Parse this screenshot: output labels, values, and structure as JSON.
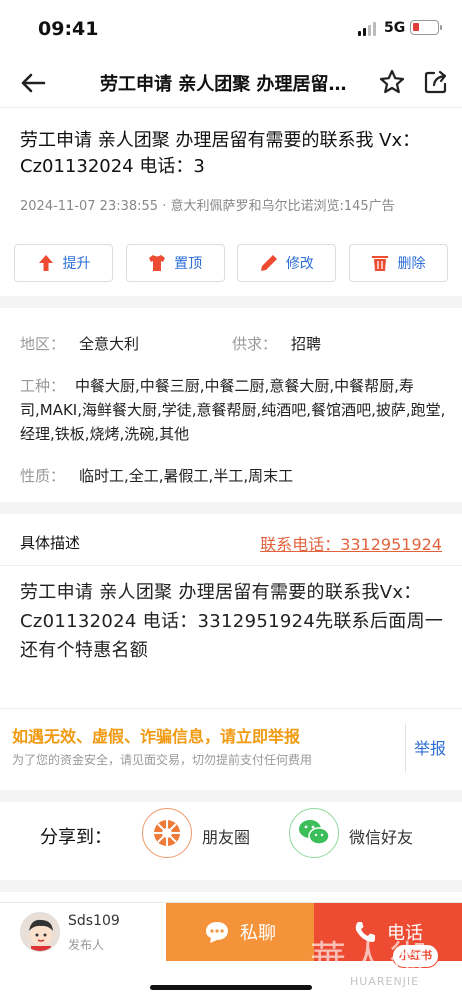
{
  "status": {
    "time": "09:41",
    "network": "5G"
  },
  "nav": {
    "title": "劳工申请 亲人团聚 办理居留有需要的联系我"
  },
  "post": {
    "title": "劳工申请 亲人团聚 办理居留有需要的联系我 Vx：Cz01132024 电话：3",
    "meta": "2024-11-07 23:38:55 · 意大利佩萨罗和乌尔比诺浏览:145广告"
  },
  "actions": [
    {
      "label": "提升",
      "icon": "arrow-up-icon"
    },
    {
      "label": "置顶",
      "icon": "shirt-icon"
    },
    {
      "label": "修改",
      "icon": "pencil-icon"
    },
    {
      "label": "删除",
      "icon": "trash-icon"
    }
  ],
  "info": {
    "region_label": "地区：",
    "region_value": "全意大利",
    "supply_label": "供求：",
    "supply_value": "招聘",
    "jobs_label": "工种：",
    "jobs_value": "中餐大厨,中餐三厨,中餐二厨,意餐大厨,中餐帮厨,寿司,MAKI,海鲜餐大厨,学徒,意餐帮厨,纯酒吧,餐馆酒吧,披萨,跑堂,经理,铁板,烧烤,洗碗,其他",
    "nature_label": "性质：",
    "nature_value": "临时工,全工,暑假工,半工,周末工"
  },
  "description": {
    "label": "具体描述",
    "phone_link": "联系电话：3312951924",
    "body": "劳工申请  亲人团聚 办理居留有需要的联系我Vx：Cz01132024  电话：3312951924先联系后面周一还有个特惠名额"
  },
  "warning": {
    "title": "如遇无效、虚假、诈骗信息，请立即举报",
    "subtitle": "为了您的资金安全，请见面交易，切勿提前支付任何费用",
    "report_label": "举报"
  },
  "share": {
    "label": "分享到：",
    "moments": "朋友圈",
    "wechat": "微信好友"
  },
  "publisher": {
    "name": "Sds109",
    "role": "发布人"
  },
  "bottom": {
    "chat_label": "私聊",
    "call_label": "电话",
    "mini_badge": "小红书"
  },
  "watermark": {
    "text": "華人街",
    "url": "HUARENJIE"
  },
  "colors": {
    "accent_blue": "#2c6fd6",
    "orange": "#f4933a",
    "red": "#ed4b32",
    "warning": "#f09a12"
  }
}
